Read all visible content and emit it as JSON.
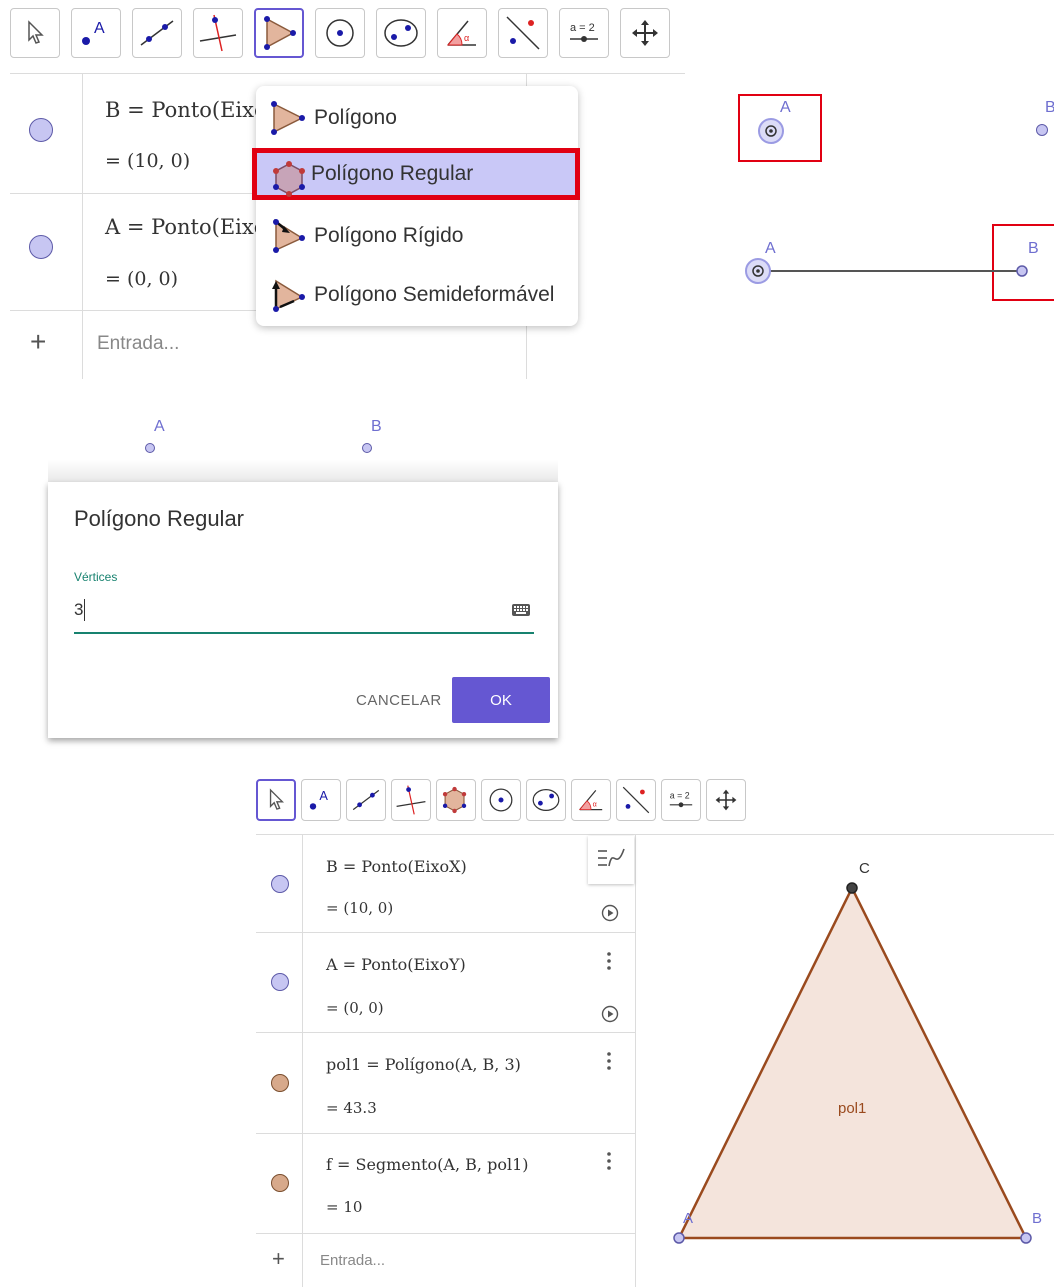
{
  "toolbar_top": {
    "tools": [
      {
        "name": "move-tool-icon",
        "label": ""
      },
      {
        "name": "point-tool-icon",
        "label": "A"
      },
      {
        "name": "line-tool-icon",
        "label": ""
      },
      {
        "name": "perpendicular-line-tool-icon",
        "label": ""
      },
      {
        "name": "polygon-tool-icon",
        "label": ""
      },
      {
        "name": "circle-tool-icon",
        "label": ""
      },
      {
        "name": "ellipse-tool-icon",
        "label": ""
      },
      {
        "name": "angle-tool-icon",
        "label": "α"
      },
      {
        "name": "reflect-tool-icon",
        "label": ""
      },
      {
        "name": "slider-tool-icon",
        "label": "a = 2"
      },
      {
        "name": "move-graphics-tool-icon",
        "label": ""
      }
    ]
  },
  "algebra_top": {
    "rows": [
      {
        "expr": "B = Ponto(Eixo",
        "value": "= (10, 0)"
      },
      {
        "expr": "A = Ponto(Eixo",
        "value": "= (0, 0)"
      }
    ],
    "input_placeholder": "Entrada...",
    "plus": "+"
  },
  "polygon_menu": {
    "items": [
      {
        "label": "Polígono"
      },
      {
        "label": "Polígono Regular"
      },
      {
        "label": "Polígono Rígido"
      },
      {
        "label": "Polígono Semideformável"
      }
    ]
  },
  "graphics_top": {
    "point_a": "A",
    "point_b": "B",
    "point_a2": "A",
    "point_b2": "B"
  },
  "dialog": {
    "pt_a": "A",
    "pt_b": "B",
    "title": "Polígono Regular",
    "field_label": "Vértices",
    "field_value": "3",
    "cancel": "CANCELAR",
    "ok": "OK"
  },
  "algebra_bottom": {
    "rows": [
      {
        "expr": "B = Ponto(EixoX)",
        "value": "= (10, 0)"
      },
      {
        "expr": "A = Ponto(EixoY)",
        "value": "= (0, 0)"
      },
      {
        "expr": "pol1 = Polígono(A, B, 3)",
        "value": "= 43.3"
      },
      {
        "expr": "f = Segmento(A, B, pol1)",
        "value": "= 10"
      }
    ],
    "input_placeholder": "Entrada...",
    "plus": "+"
  },
  "graphics_bottom": {
    "vertex_a": "A",
    "vertex_b": "B",
    "vertex_c": "C",
    "polygon_label": "pol1"
  },
  "colors": {
    "accent": "#6557d2",
    "highlight_red": "#e10012",
    "point_blue": "#5d5aa8",
    "polygon_stroke": "#9a4a1e",
    "polygon_fill": "#f4e4dc",
    "teal_label": "#17826f"
  }
}
